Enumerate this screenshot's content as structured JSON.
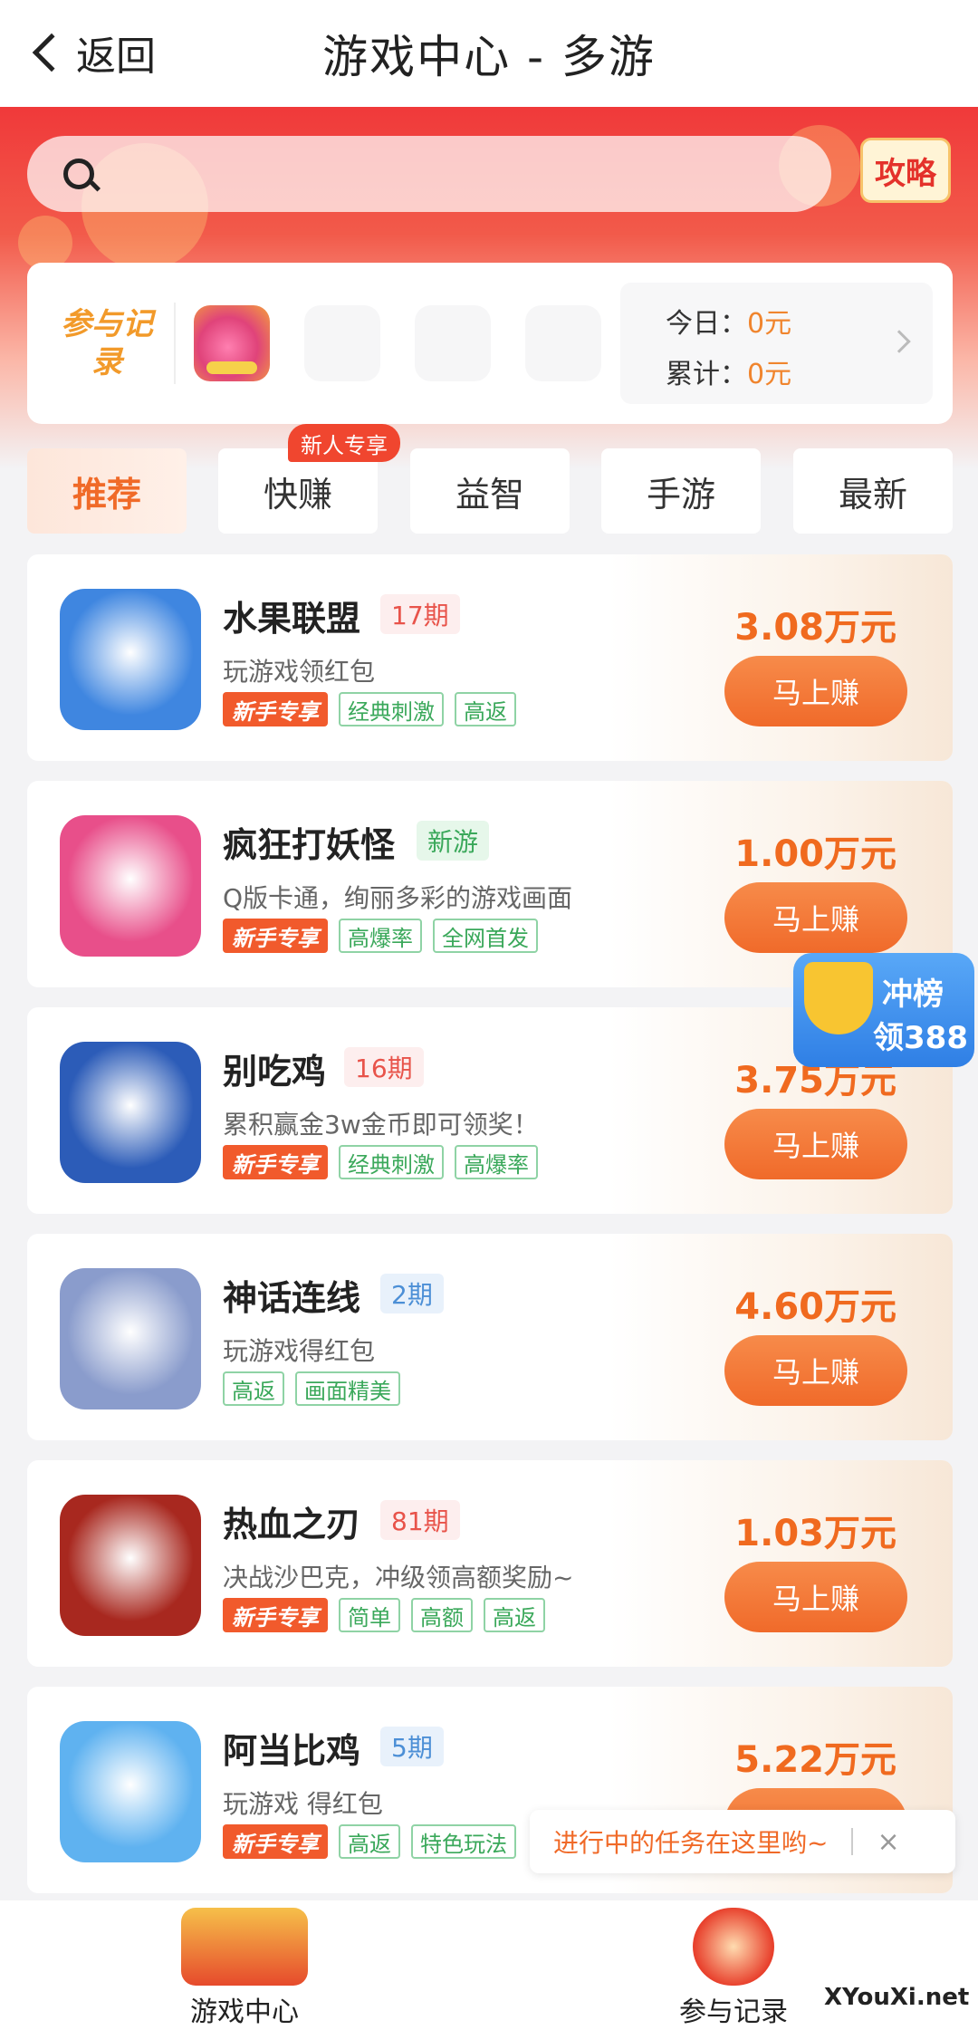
{
  "topbar": {
    "back_label": "返回",
    "title": "游戏中心 - 多游"
  },
  "search": {
    "placeholder": ""
  },
  "guide_label": "攻略",
  "record": {
    "title": "参与记录",
    "today_label": "今日：",
    "today_value": "0元",
    "total_label": "累计：",
    "total_value": "0元"
  },
  "tabs": [
    {
      "label": "推荐",
      "active": true
    },
    {
      "label": "快赚",
      "active": false
    },
    {
      "label": "益智",
      "active": false
    },
    {
      "label": "手游",
      "active": false
    },
    {
      "label": "最新",
      "active": false
    }
  ],
  "new_user_badge": "新人专享",
  "games": [
    {
      "name": "水果联盟",
      "period": "17期",
      "period_style": "red",
      "desc": "玩游戏领红包",
      "new_tag": "新手专享",
      "tags": [
        "经典刺激",
        "高返"
      ],
      "amount": "3.08万元",
      "button": "马上赚",
      "icon_color": "#3f86e0"
    },
    {
      "name": "疯狂打妖怪",
      "period": "新游",
      "period_style": "green",
      "desc": "Q版卡通，绚丽多彩的游戏画面",
      "new_tag": "新手专享",
      "tags": [
        "高爆率",
        "全网首发"
      ],
      "amount": "1.00万元",
      "button": "马上赚",
      "icon_color": "#e84f8a"
    },
    {
      "name": "别吃鸡",
      "period": "16期",
      "period_style": "red",
      "desc": "累积赢金3w金币即可领奖！",
      "new_tag": "新手专享",
      "tags": [
        "经典刺激",
        "高爆率"
      ],
      "amount": "3.75万元",
      "button": "马上赚",
      "icon_color": "#2c5cb8"
    },
    {
      "name": "神话连线",
      "period": "2期",
      "period_style": "blue",
      "desc": "玩游戏得红包",
      "new_tag": "",
      "tags": [
        "高返",
        "画面精美"
      ],
      "amount": "4.60万元",
      "button": "马上赚",
      "icon_color": "#8a9ccc"
    },
    {
      "name": "热血之刃",
      "period": "81期",
      "period_style": "red",
      "desc": "决战沙巴克，冲级领高额奖励~",
      "new_tag": "新手专享",
      "tags": [
        "简单",
        "高额",
        "高返"
      ],
      "amount": "1.03万元",
      "button": "马上赚",
      "icon_color": "#a8281f"
    },
    {
      "name": "阿当比鸡",
      "period": "5期",
      "period_style": "blue",
      "desc": "玩游戏 得红包",
      "new_tag": "新手专享",
      "tags": [
        "高返",
        "特色玩法"
      ],
      "amount": "5.22万元",
      "button": "马上赚",
      "icon_color": "#5fb2f0"
    }
  ],
  "rank_badge": {
    "line1": "冲榜",
    "line2": "领388"
  },
  "tip": {
    "text": "进行中的任务在这里哟~",
    "close": "×"
  },
  "bottomnav": [
    {
      "label": "游戏中心"
    },
    {
      "label": "参与记录"
    }
  ],
  "watermark": "XYouXi.net"
}
